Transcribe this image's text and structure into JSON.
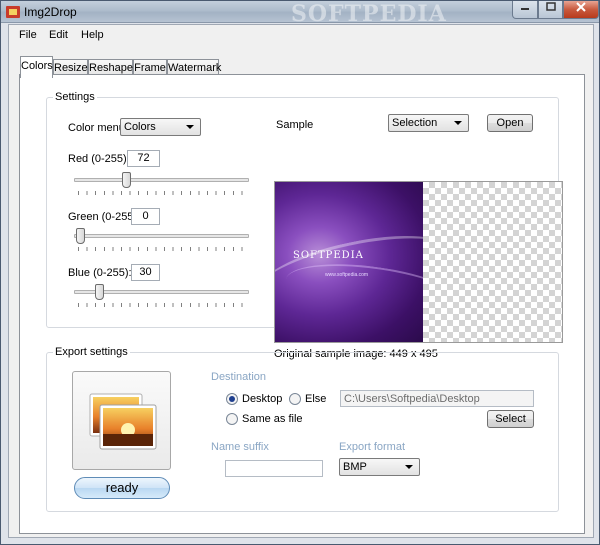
{
  "window": {
    "title": "Img2Drop",
    "watermark": "SOFTPEDIA"
  },
  "menu": [
    "File",
    "Edit",
    "Help"
  ],
  "tabs": [
    "Colors",
    "Resize",
    "Reshape",
    "Frame",
    "Watermark"
  ],
  "settings": {
    "group_label": "Settings",
    "color_menu_label": "Color menu:",
    "color_menu_value": "Colors",
    "red": {
      "label": "Red (0-255):",
      "value": "72",
      "level": 72
    },
    "green": {
      "label": "Green (0-255):",
      "value": "0",
      "level": 0
    },
    "blue": {
      "label": "Blue (0-255):",
      "value": "30",
      "level": 30
    },
    "sample_label": "Sample",
    "sample_mode": "Selection",
    "open_button": "Open",
    "sample_logo": "SOFTPEDIA",
    "sample_url": "www.softpedia.com",
    "original_size": "Original sample image: 449 x 495"
  },
  "export": {
    "group_label": "Export settings",
    "ready_button": "ready",
    "destination_label": "Destination",
    "desktop_label": "Desktop",
    "else_label": "Else",
    "same_as_file_label": "Same as file",
    "destination_selected": "Desktop",
    "path_value": "C:\\Users\\Softpedia\\Desktop",
    "select_button": "Select",
    "name_suffix_label": "Name suffix",
    "name_suffix_value": "",
    "export_format_label": "Export format",
    "export_format_value": "BMP"
  },
  "colors": {
    "close_button": "#c85a3e",
    "ready_button": "#cfe4f7",
    "disabled_label": "#8aa6c4"
  }
}
